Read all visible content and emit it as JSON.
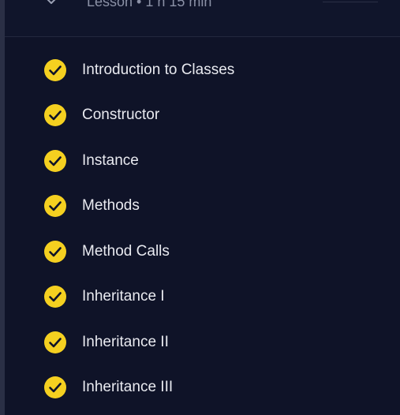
{
  "header": {
    "subtitle": "Lesson • 1 h 15 min"
  },
  "lessons": [
    {
      "label": "Introduction to Classes",
      "status": "completed"
    },
    {
      "label": "Constructor",
      "status": "completed"
    },
    {
      "label": "Instance",
      "status": "completed"
    },
    {
      "label": "Methods",
      "status": "completed"
    },
    {
      "label": "Method Calls",
      "status": "completed"
    },
    {
      "label": "Inheritance I",
      "status": "completed"
    },
    {
      "label": "Inheritance II",
      "status": "completed"
    },
    {
      "label": "Inheritance III",
      "status": "completed"
    }
  ],
  "colors": {
    "background": "#0f1328",
    "check_fill": "#f5d020",
    "check_mark": "#0f1328",
    "label_text": "#e9eaf0"
  },
  "icons": {
    "header": "chevron-down-icon",
    "completed": "check-circle-icon"
  }
}
